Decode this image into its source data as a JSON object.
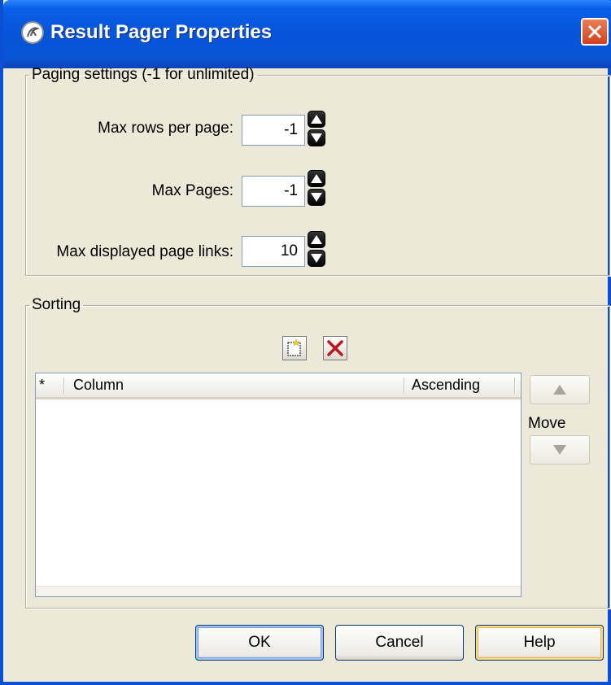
{
  "window": {
    "title": "Result Pager Properties"
  },
  "paging": {
    "legend": "Paging settings (-1 for unlimited)",
    "fields": [
      {
        "label": "Max rows per page:",
        "value": "-1"
      },
      {
        "label": "Max Pages:",
        "value": "-1"
      },
      {
        "label": "Max displayed page links:",
        "value": "10"
      }
    ]
  },
  "sorting": {
    "legend": "Sorting",
    "columns": [
      "*",
      "Column",
      "Ascending"
    ],
    "rows": [],
    "move_label": "Move"
  },
  "buttons": {
    "ok": "OK",
    "cancel": "Cancel",
    "help": "Help"
  }
}
